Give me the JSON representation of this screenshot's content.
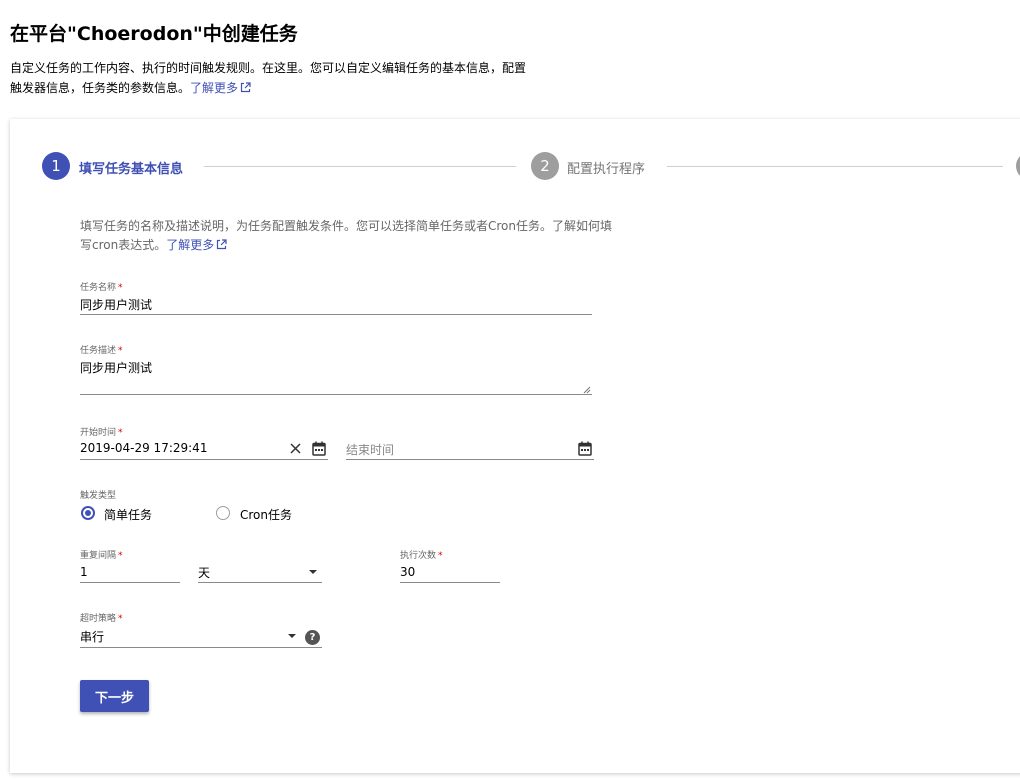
{
  "header": {
    "title": "在平台\"Choerodon\"中创建任务",
    "description": "自定义任务的工作内容、执行的时间触发规则。在这里。您可以自定义编辑任务的基本信息，配置触发器信息，任务类的参数信息。",
    "learn_more": "了解更多"
  },
  "steps": [
    {
      "number": "1",
      "label": "填写任务基本信息",
      "state": "active"
    },
    {
      "number": "2",
      "label": "配置执行程序",
      "state": "inactive"
    }
  ],
  "form": {
    "instructions": "填写任务的名称及描述说明，为任务配置触发条件。您可以选择简单任务或者Cron任务。了解如何填写cron表达式。",
    "learn_more": "了解更多",
    "required_mark": "*",
    "name": {
      "label": "任务名称",
      "value": "同步用户测试"
    },
    "description": {
      "label": "任务描述",
      "value": "同步用户测试"
    },
    "start_time": {
      "label": "开始时间",
      "value": "2019-04-29 17:29:41"
    },
    "end_time": {
      "placeholder": "结束时间"
    },
    "trigger_type": {
      "label": "触发类型",
      "options": [
        {
          "label": "简单任务",
          "checked": true
        },
        {
          "label": "Cron任务",
          "checked": false
        }
      ]
    },
    "repeat_interval": {
      "label": "重复间隔",
      "value": "1",
      "unit": "天"
    },
    "exec_count": {
      "label": "执行次数",
      "value": "30"
    },
    "timeout_policy": {
      "label": "超时策略",
      "value": "串行"
    },
    "next_button": "下一步"
  },
  "colors": {
    "primary": "#3f51b5",
    "step_inactive": "#9e9e9e",
    "required": "#d50000"
  }
}
